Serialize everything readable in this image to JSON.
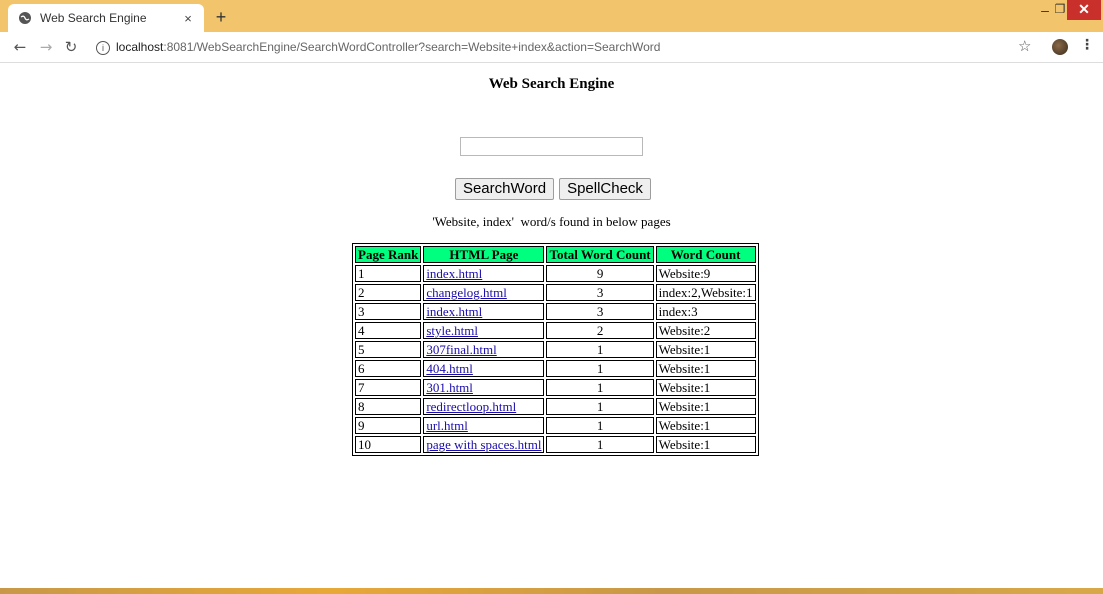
{
  "browser": {
    "tab_title": "Web Search Engine",
    "tab_close": "×",
    "new_tab": "+",
    "url_host": "localhost",
    "url_rest": ":8081/WebSearchEngine/SearchWordController?search=Website+index&action=SearchWord"
  },
  "page": {
    "title": "Web Search Engine",
    "search_value": "",
    "search_button": "SearchWord",
    "spell_button": "SpellCheck",
    "result_message": "'Website, index'  word/s found in below pages"
  },
  "table": {
    "headers": [
      "Page Rank",
      "HTML Page",
      "Total Word Count",
      "Word Count"
    ],
    "rows": [
      {
        "rank": "1",
        "page": "index.html",
        "total": "9",
        "count": "Website:9"
      },
      {
        "rank": "2",
        "page": "changelog.html",
        "total": "3",
        "count": "index:2,Website:1"
      },
      {
        "rank": "3",
        "page": "index.html",
        "total": "3",
        "count": "index:3"
      },
      {
        "rank": "4",
        "page": "style.html",
        "total": "2",
        "count": "Website:2"
      },
      {
        "rank": "5",
        "page": "307final.html",
        "total": "1",
        "count": "Website:1"
      },
      {
        "rank": "6",
        "page": "404.html",
        "total": "1",
        "count": "Website:1"
      },
      {
        "rank": "7",
        "page": "301.html",
        "total": "1",
        "count": "Website:1"
      },
      {
        "rank": "8",
        "page": "redirectloop.html",
        "total": "1",
        "count": "Website:1"
      },
      {
        "rank": "9",
        "page": "url.html",
        "total": "1",
        "count": "Website:1"
      },
      {
        "rank": "10",
        "page": "page with spaces.html",
        "total": "1",
        "count": "Website:1"
      }
    ]
  },
  "colors": {
    "tabstrip": "#f2c46c",
    "header_bg": "#00ff7f",
    "link": "#1a0dab"
  }
}
